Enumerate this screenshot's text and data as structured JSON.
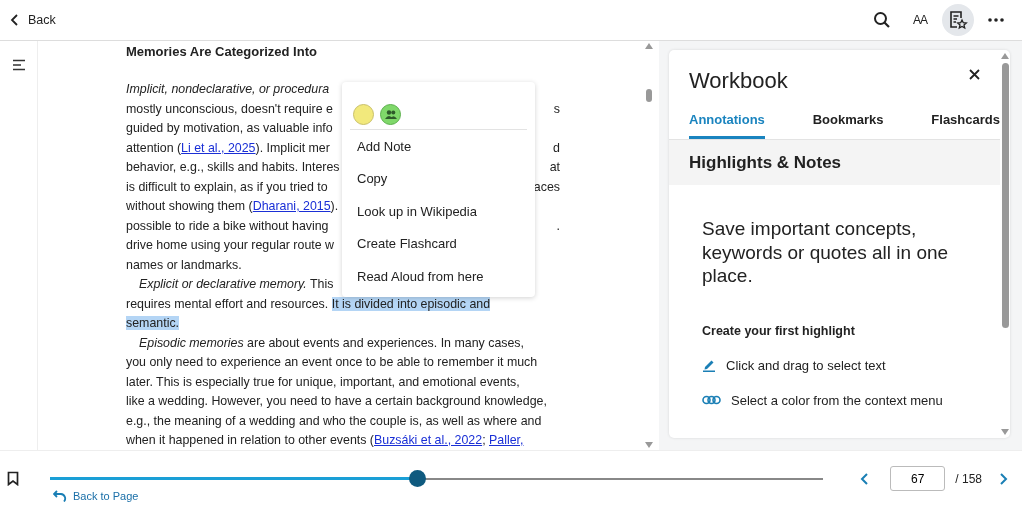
{
  "top_bar": {
    "back": "Back",
    "tools": [
      {
        "kind": "search",
        "selected": false
      },
      {
        "kind": "text-size",
        "label": "AA",
        "selected": false
      },
      {
        "kind": "workbook",
        "selected": true
      },
      {
        "kind": "more",
        "selected": false
      }
    ]
  },
  "reader": {
    "heading": "Memories Are Categorized Into",
    "lines": [
      {
        "indent": false,
        "parts": [
          {
            "kind": "italic",
            "text": "Implicit, nondeclarative, or procedura"
          }
        ]
      },
      {
        "indent": false,
        "parts": [
          {
            "kind": "plain",
            "text": "mostly unconscious, doesn't require e"
          }
        ],
        "tail": "s"
      },
      {
        "indent": false,
        "parts": [
          {
            "kind": "plain",
            "text": "guided by motivation, as valuable info"
          }
        ]
      },
      {
        "indent": false,
        "parts": [
          {
            "kind": "plain",
            "text": "attention ("
          },
          {
            "kind": "link",
            "text": "Li et al., 2025"
          },
          {
            "kind": "plain",
            "text": "). Implicit mer"
          }
        ],
        "tail": "d"
      },
      {
        "indent": false,
        "parts": [
          {
            "kind": "plain",
            "text": "behavior, e.g., skills and habits. Interes"
          }
        ],
        "tail": "at"
      },
      {
        "indent": false,
        "parts": [
          {
            "kind": "plain",
            "text": "is difficult to explain, as if you tried to"
          }
        ],
        "tail": "aces"
      },
      {
        "indent": false,
        "parts": [
          {
            "kind": "plain",
            "text": "without showing them ("
          },
          {
            "kind": "link",
            "text": "Dharani, 2015"
          },
          {
            "kind": "plain",
            "text": ")."
          }
        ]
      },
      {
        "indent": false,
        "parts": [
          {
            "kind": "plain",
            "text": "possible to ride a bike without having"
          }
        ],
        "tail": "."
      },
      {
        "indent": false,
        "parts": [
          {
            "kind": "plain",
            "text": "drive home using your regular route w"
          }
        ]
      },
      {
        "indent": false,
        "parts": [
          {
            "kind": "plain",
            "text": "names or landmarks."
          }
        ]
      },
      {
        "indent": true,
        "parts": [
          {
            "kind": "italic",
            "text": "Explicit or declarative memory."
          },
          {
            "kind": "plain",
            "text": " This"
          }
        ]
      },
      {
        "indent": false,
        "parts": [
          {
            "kind": "plain",
            "text": "requires mental effort and resources. "
          },
          {
            "kind": "highlight",
            "text": "It is divided into episodic and"
          }
        ]
      },
      {
        "indent": false,
        "parts": [
          {
            "kind": "highlight",
            "text": "semantic."
          }
        ]
      },
      {
        "indent": true,
        "parts": [
          {
            "kind": "italic",
            "text": "Episodic memories"
          },
          {
            "kind": "plain",
            "text": " are about events and experiences. In many cases,"
          }
        ]
      },
      {
        "indent": false,
        "parts": [
          {
            "kind": "plain",
            "text": "you only need to experience an event once to be able to remember it much"
          }
        ]
      },
      {
        "indent": false,
        "parts": [
          {
            "kind": "plain",
            "text": "later. This is especially true for unique, important, and emotional events,"
          }
        ]
      },
      {
        "indent": false,
        "parts": [
          {
            "kind": "plain",
            "text": "like a wedding. However, you need to have a certain background knowledge,"
          }
        ]
      },
      {
        "indent": false,
        "parts": [
          {
            "kind": "plain",
            "text": "e.g., the meaning of a wedding and who the couple is, as well as where and"
          }
        ]
      },
      {
        "indent": false,
        "parts": [
          {
            "kind": "plain",
            "text": "when it happened in relation to other events ("
          },
          {
            "kind": "link",
            "text": "Buzsáki et al., 2022"
          },
          {
            "kind": "plain",
            "text": "; "
          },
          {
            "kind": "link",
            "text": "Paller,"
          }
        ]
      }
    ]
  },
  "context_menu": {
    "swatches": [
      {
        "kind": "plain",
        "color": "#f2e97c"
      },
      {
        "kind": "group",
        "color": "#7fd86a"
      }
    ],
    "items": [
      "Add Note",
      "Copy",
      "Look up in Wikipedia",
      "Create Flashcard",
      "Read Aloud from here"
    ]
  },
  "workbook": {
    "title": "Workbook",
    "tabs": [
      {
        "label": "Annotations",
        "selected": true
      },
      {
        "label": "Bookmarks",
        "selected": false
      },
      {
        "label": "Flashcards",
        "selected": false
      }
    ],
    "section": "Highlights & Notes",
    "message": "Save important concepts, keywords or quotes all in one place.",
    "subheading": "Create your first highlight",
    "steps": [
      {
        "kind": "pen",
        "text": "Click and drag to select text"
      },
      {
        "kind": "colors",
        "text": "Select a color from the context menu"
      }
    ]
  },
  "bottom_bar": {
    "progress": {
      "level": 0.475
    },
    "back_to_page": "Back to Page",
    "page": "67",
    "total": "/ 158"
  }
}
